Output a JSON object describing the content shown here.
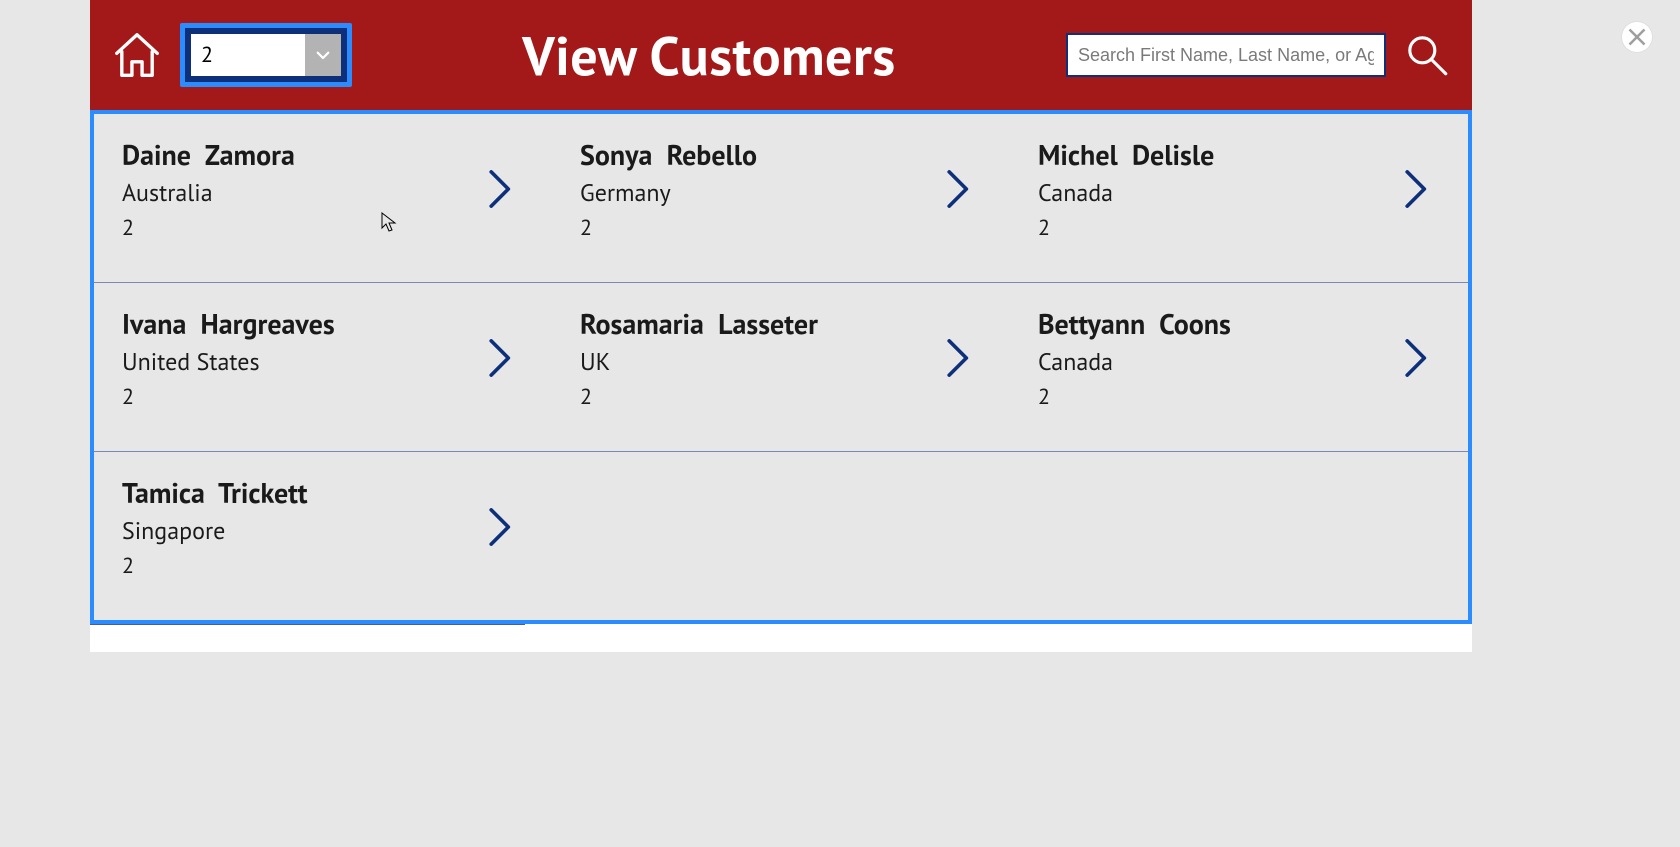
{
  "header": {
    "title": "View Customers",
    "filter_value": "2",
    "search_placeholder": "Search First Name, Last Name, or Age"
  },
  "customers": [
    {
      "first": "Daine",
      "last": "Zamora",
      "country": "Australia",
      "age": "2"
    },
    {
      "first": "Sonya",
      "last": "Rebello",
      "country": "Germany",
      "age": "2"
    },
    {
      "first": "Michel",
      "last": "Delisle",
      "country": "Canada",
      "age": "2"
    },
    {
      "first": "Ivana",
      "last": "Hargreaves",
      "country": "United States",
      "age": "2"
    },
    {
      "first": "Rosamaria",
      "last": "Lasseter",
      "country": "UK",
      "age": "2"
    },
    {
      "first": "Bettyann",
      "last": "Coons",
      "country": "Canada",
      "age": "2"
    },
    {
      "first": "Tamica",
      "last": "Trickett",
      "country": "Singapore",
      "age": "2"
    }
  ],
  "colors": {
    "brand_red": "#A31919",
    "dark_blue": "#0E2F7A",
    "highlight_blue": "#2A8CFF"
  }
}
